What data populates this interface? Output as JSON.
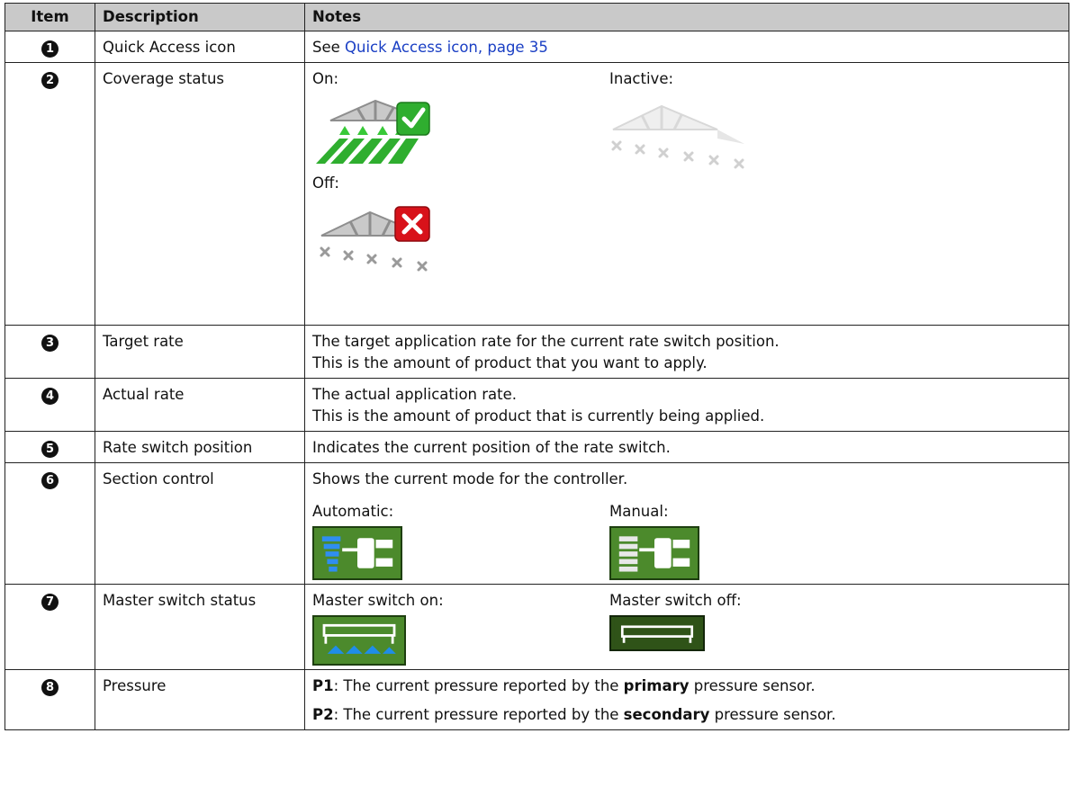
{
  "headers": {
    "item": "Item",
    "description": "Description",
    "notes": "Notes"
  },
  "rows": {
    "r1": {
      "num": "1",
      "description": "Quick Access icon",
      "notes_prefix": "See ",
      "link": "Quick Access icon, page 35"
    },
    "r2": {
      "num": "2",
      "description": "Coverage status",
      "on": "On:",
      "inactive": "Inactive:",
      "off": "Off:"
    },
    "r3": {
      "num": "3",
      "description": "Target rate",
      "line1": "The target application rate for the current rate switch position.",
      "line2": "This is the amount of product that you want to apply."
    },
    "r4": {
      "num": "4",
      "description": "Actual rate",
      "line1": "The actual application rate.",
      "line2": "This is the amount of product that is currently being applied."
    },
    "r5": {
      "num": "5",
      "description": "Rate switch position",
      "line1": "Indicates the current position of the rate switch."
    },
    "r6": {
      "num": "6",
      "description": "Section control",
      "line1": "Shows the current mode for the controller.",
      "automatic": "Automatic:",
      "manual": "Manual:"
    },
    "r7": {
      "num": "7",
      "description": "Master switch status",
      "on": "Master switch on:",
      "off": "Master switch off:"
    },
    "r8": {
      "num": "8",
      "description": "Pressure",
      "p1_label": "P1",
      "p1_text_a": ": The current pressure reported by the ",
      "p1_bold": "primary",
      "p1_text_b": " pressure sensor.",
      "p2_label": "P2",
      "p2_text_a": ": The current pressure reported by the ",
      "p2_bold": "secondary",
      "p2_text_b": " pressure sensor."
    }
  },
  "colors": {
    "header_bg": "#c9c9c9",
    "link": "#1a3fc4",
    "green_ok": "#2fae2f",
    "red_x": "#d8121a",
    "icon_green": "#4c8a2c"
  },
  "icons": [
    "coverage-on-icon",
    "coverage-inactive-icon",
    "coverage-off-icon",
    "section-auto-icon",
    "section-manual-icon",
    "master-switch-on-icon",
    "master-switch-off-icon"
  ]
}
